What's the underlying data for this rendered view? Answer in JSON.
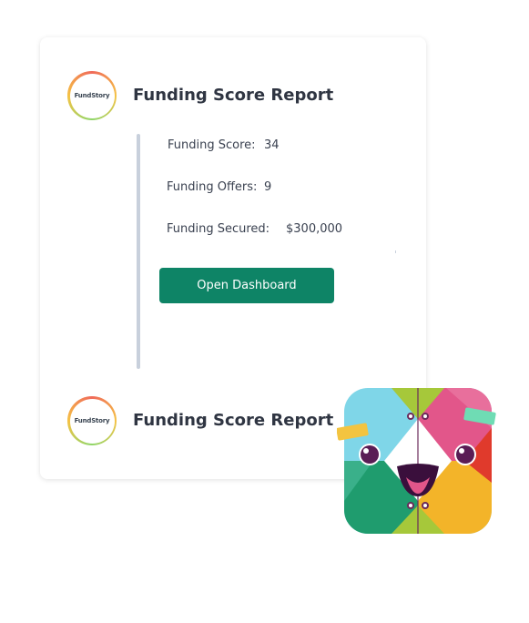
{
  "card": {
    "report_top": {
      "logo_text": "FundStory",
      "title": "Funding Score Report"
    },
    "details": [
      {
        "label": "Funding Score:",
        "value": "34"
      },
      {
        "label": "Funding Offers:",
        "value": "9"
      },
      {
        "label": "Funding Secured:",
        "value": "$300,000"
      }
    ],
    "button_label": "Open Dashboard",
    "report_bottom": {
      "logo_text": "FundStory",
      "title": "Funding Score Report"
    }
  },
  "app_icon": {
    "name": "slack-style-mascot-icon",
    "colors": {
      "cyan": "#7fd6e8",
      "pink": "#e2568a",
      "red": "#e03a2c",
      "green": "#1f9c6e",
      "yellow": "#f3b429",
      "lime": "#a6c83a",
      "mouth": "#3a0f3c"
    }
  },
  "colors": {
    "accent": "#0e8466",
    "title": "#2f3542",
    "divider": "#c8d0dc"
  }
}
